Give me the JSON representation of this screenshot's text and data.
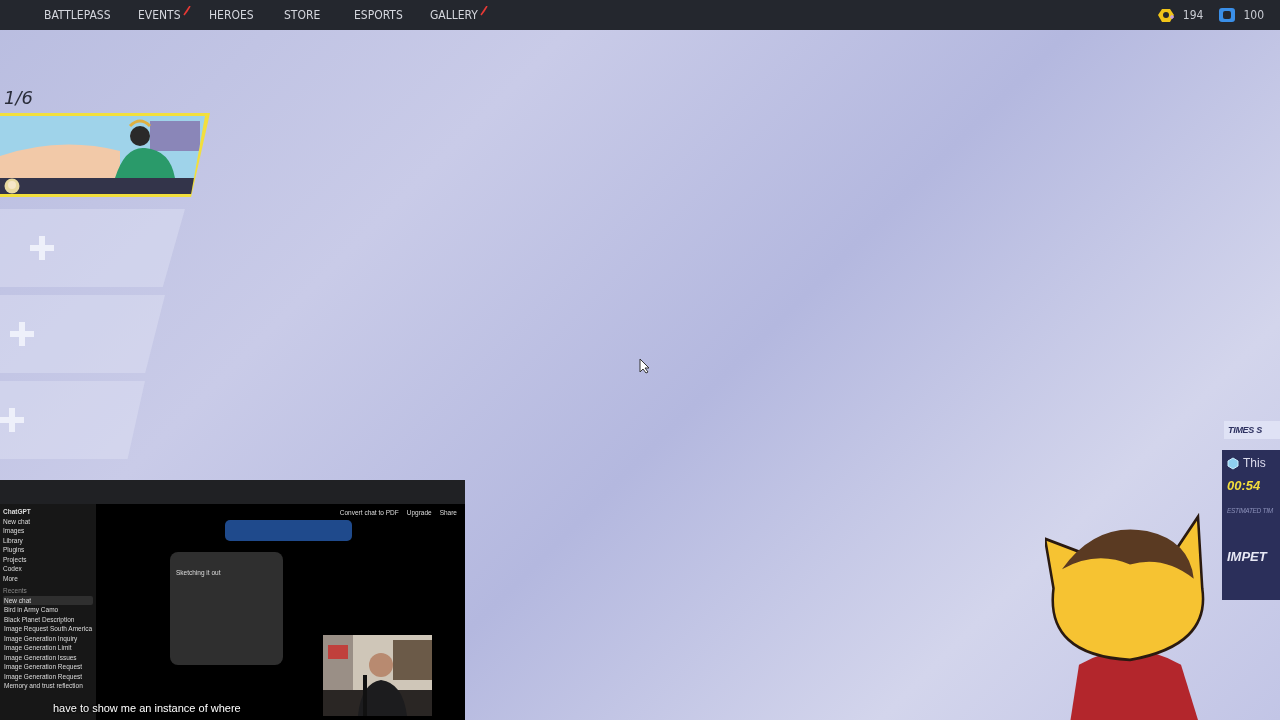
{
  "nav": {
    "tabs": [
      {
        "label": "BATTLEPASS",
        "new": false
      },
      {
        "label": "EVENTS",
        "new": true
      },
      {
        "label": "HEROES",
        "new": false
      },
      {
        "label": "STORE",
        "new": false
      },
      {
        "label": "ESPORTS",
        "new": false
      },
      {
        "label": "GALLERY",
        "new": true
      }
    ]
  },
  "currencies": [
    {
      "kind": "gold",
      "amount": "194"
    },
    {
      "kind": "blue",
      "amount": "100"
    }
  ],
  "team": {
    "count": "1/6",
    "slots": [
      {
        "kind": "hero"
      },
      {
        "kind": "empty"
      },
      {
        "kind": "empty"
      },
      {
        "kind": "empty"
      }
    ]
  },
  "matchmaking": {
    "tab": "TIMES S",
    "title": "This",
    "timer": "00:54",
    "label": "ESTIMATED TIM",
    "mode": "IMPET"
  },
  "stream": {
    "app": {
      "title": "ChatGPT",
      "menu": [
        "New chat",
        "Images",
        "Library",
        "Plugins",
        "Projects",
        "Codex",
        "More"
      ],
      "section": "Recents",
      "chats": [
        {
          "label": "New chat",
          "selected": true
        },
        {
          "label": "Bird in Army Camo",
          "selected": false
        },
        {
          "label": "Black Planet Description",
          "selected": false
        },
        {
          "label": "Image Request South America",
          "selected": false
        },
        {
          "label": "Image Generation Inquiry",
          "selected": false
        },
        {
          "label": "Image Generation Limit",
          "selected": false
        },
        {
          "label": "Image Generation Issues",
          "selected": false
        },
        {
          "label": "Image Generation Request",
          "selected": false
        },
        {
          "label": "Image Generation Request",
          "selected": false
        },
        {
          "label": "Memory and trust reflection",
          "selected": false
        }
      ],
      "actions": [
        "Convert chat to PDF",
        "Upgrade",
        "Share"
      ],
      "status": "Sketching it out"
    },
    "caption": "have to show me an instance of where"
  }
}
